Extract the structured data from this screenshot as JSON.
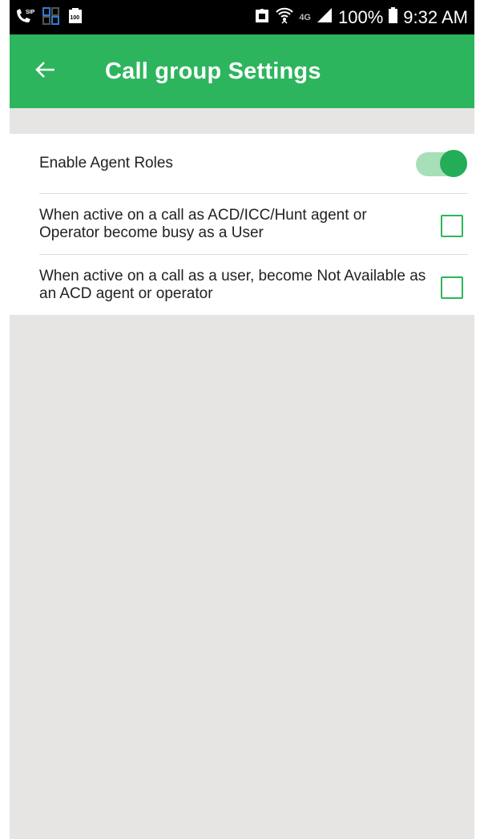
{
  "status_bar": {
    "battery_percent": "100%",
    "time": "9:32 AM",
    "network_label": "4G",
    "icons": [
      "sip-call-icon",
      "screen-mirror-icon",
      "battery-saver-icon",
      "lock-icon",
      "wifi-icon",
      "signal-icon",
      "battery-icon"
    ]
  },
  "app_bar": {
    "title": "Call group Settings",
    "back_icon": "back-arrow-icon"
  },
  "settings": {
    "enable_agent_roles": {
      "label": "Enable Agent Roles",
      "enabled": true
    },
    "busy_as_user": {
      "label": "When active on a call as ACD/ICC/Hunt agent or Operator become busy as a User",
      "checked": false
    },
    "not_available_as_agent": {
      "label": "When active on a call as a user, become Not Available as an ACD agent or operator",
      "checked": false
    }
  },
  "colors": {
    "accent": "#2db55d",
    "toggle_track": "#a7dfb9",
    "background": "#e6e5e4"
  }
}
